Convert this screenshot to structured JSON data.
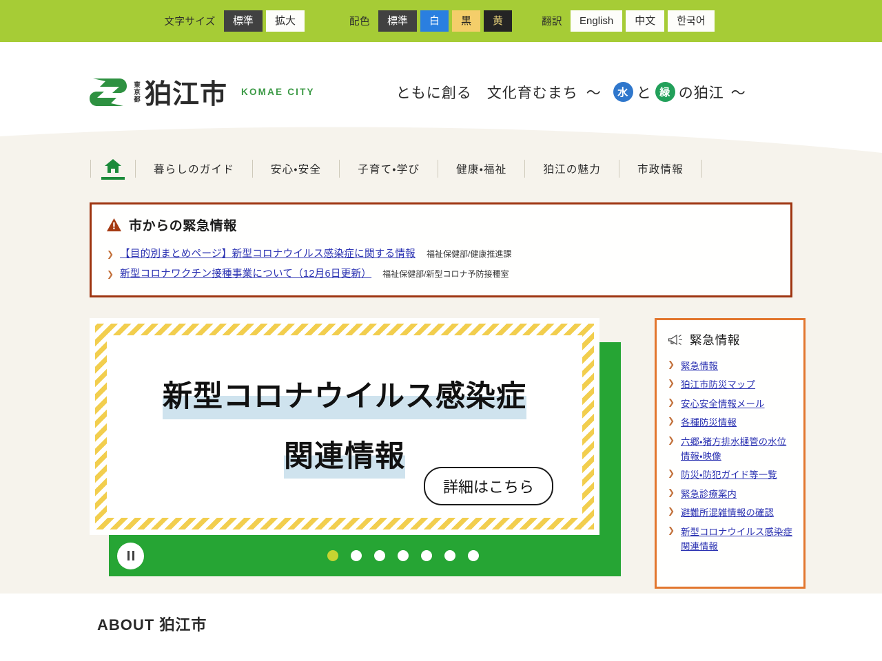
{
  "utilbar": {
    "fontsize_label": "文字サイズ",
    "fontsize_options": [
      {
        "label": "標準",
        "style": "dark"
      },
      {
        "label": "拡大",
        "style": "white"
      }
    ],
    "colorscheme_label": "配色",
    "colorscheme_options": [
      {
        "label": "標準",
        "style": "dark"
      },
      {
        "label": "白",
        "style": "blue"
      },
      {
        "label": "黒",
        "style": "yellow"
      },
      {
        "label": "黄",
        "style": "black"
      }
    ],
    "translate_label": "翻訳",
    "translate_options": [
      {
        "label": "English"
      },
      {
        "label": "中文"
      },
      {
        "label": "한국어"
      }
    ]
  },
  "header": {
    "logo_prefecture": "東京都",
    "logo_city": "狛江市",
    "logo_english": "KOMAE CITY",
    "tagline_part1": "ともに創る　文化育むまち",
    "tagline_tilde_left": "〜",
    "tagline_water": "水",
    "tagline_and": "と",
    "tagline_green": "緑",
    "tagline_part2": "の狛江",
    "tagline_tilde_right": "〜"
  },
  "nav": {
    "home_icon": "home-icon",
    "items": [
      {
        "label": "暮らしのガイド"
      },
      {
        "label": "安心・安全"
      },
      {
        "label": "子育て・学び"
      },
      {
        "label": "健康・福祉"
      },
      {
        "label": "狛江の魅力"
      },
      {
        "label": "市政情報"
      }
    ]
  },
  "notice": {
    "title": "市からの緊急情報",
    "items": [
      {
        "link": "【目的別まとめページ】新型コロナウイルス感染症に関する情報",
        "dept": "福祉保健部/健康推進課"
      },
      {
        "link": "新型コロナワクチン接種事業について（12月6日更新）",
        "dept": "福祉保健部/新型コロナ予防接種室"
      }
    ]
  },
  "slider": {
    "banner_line1": "新型コロナウイルス感染症",
    "banner_line2": "関連情報",
    "banner_cta": "詳細はこちら",
    "pause_label": "一時停止",
    "dots": [
      {
        "active": true
      },
      {
        "active": false
      },
      {
        "active": false
      },
      {
        "active": false
      },
      {
        "active": false
      },
      {
        "active": false
      },
      {
        "active": false
      }
    ]
  },
  "side_panel": {
    "title": "緊急情報",
    "links": [
      "緊急情報",
      "狛江市防災マップ",
      "安心安全情報メール",
      "各種防災情報",
      "六郷・猪方排水樋管の水位情報・映像",
      "防災・防犯ガイド等一覧",
      "緊急診療案内",
      "避難所混雑情報の確認",
      "新型コロナウイルス感染症関連情報"
    ]
  },
  "about": {
    "title": "ABOUT 狛江市"
  },
  "colors": {
    "utilbar_green": "#a6cc36",
    "brand_green": "#3c9a46",
    "slider_green": "#26a534",
    "notice_border": "#9e3410",
    "panel_border": "#e2762e",
    "link_blue": "#2b32b2",
    "cream_bg": "#f6f3ec",
    "stripe_yellow": "#f2ce4e",
    "highlight_blue": "#cfe3ee"
  }
}
